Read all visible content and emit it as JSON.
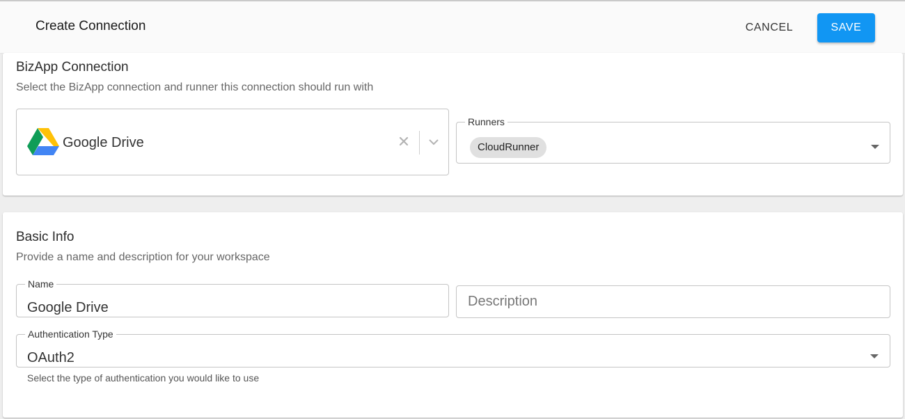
{
  "header": {
    "title": "Create Connection",
    "cancel_label": "CANCEL",
    "save_label": "SAVE",
    "save_color": "#1196f3"
  },
  "bizapp_section": {
    "title": "BizApp Connection",
    "subtitle": "Select the BizApp connection and runner this connection should run with",
    "connection": {
      "value": "Google Drive",
      "icon": "google-drive-logo"
    },
    "runners": {
      "label": "Runners",
      "selected": [
        "CloudRunner"
      ]
    }
  },
  "basic_info": {
    "title": "Basic Info",
    "subtitle": "Provide a name and description for your workspace",
    "name": {
      "label": "Name",
      "value": "Google Drive"
    },
    "description": {
      "placeholder": "Description",
      "value": ""
    },
    "auth_type": {
      "label": "Authentication Type",
      "value": "OAuth2",
      "helper": "Select the type of authentication you would like to use"
    }
  }
}
